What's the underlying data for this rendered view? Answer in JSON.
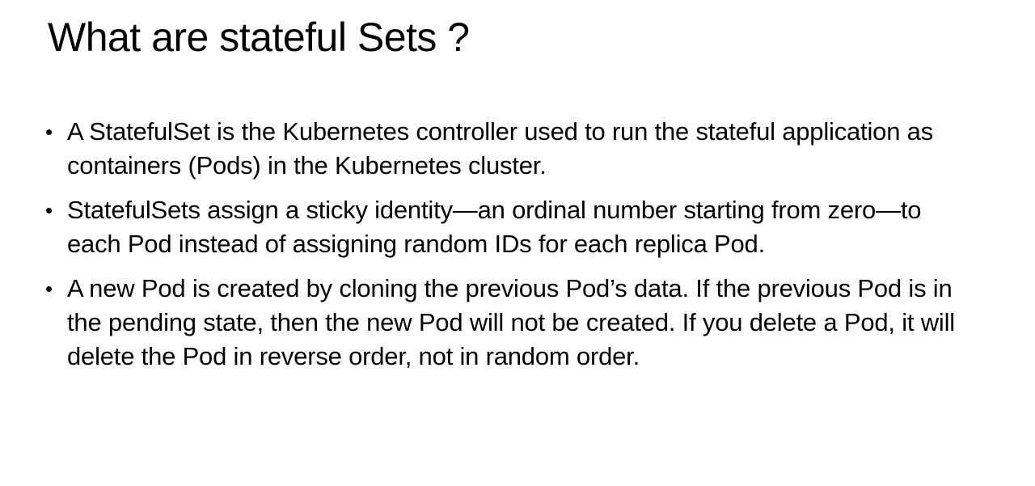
{
  "slide": {
    "title": "What are stateful Sets ?",
    "bullet_glyph": "•",
    "bullets": [
      "A StatefulSet is the Kubernetes controller used to run the stateful application as containers (Pods) in the Kubernetes cluster.",
      "StatefulSets assign a sticky identity—an ordinal number starting from zero—to each Pod instead of assigning random IDs for each replica Pod.",
      "A new Pod is created by cloning the previous Pod’s data. If the previous Pod is in the pending state, then the new Pod will not be created. If you delete a Pod, it will delete the Pod in reverse order, not in random order."
    ]
  }
}
